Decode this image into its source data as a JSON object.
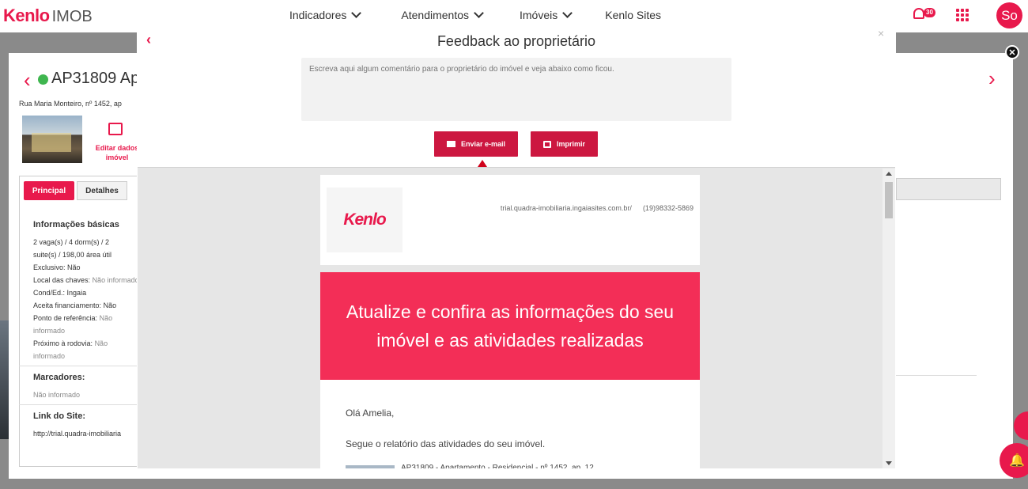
{
  "header": {
    "logo_brand": "Kenlo",
    "logo_product": "IMOB",
    "nav": [
      {
        "label": "Indicadores",
        "has_dropdown": true
      },
      {
        "label": "Atendimentos",
        "has_dropdown": true
      },
      {
        "label": "Imóveis",
        "has_dropdown": true
      },
      {
        "label": "Kenlo Sites",
        "has_dropdown": false
      }
    ],
    "notification_count": "30",
    "avatar_initials": "So",
    "accent_color": "#e8194c"
  },
  "property": {
    "code": "AP31809",
    "title_fragment": "Ap",
    "status_color": "#3fb64f",
    "address": "Rua Maria Monteiro, nº 1452, ap",
    "edit_label": "Editar dados imóvel",
    "tabs": [
      "Principal",
      "Detalhes"
    ],
    "basic_info_title": "Informações básicas",
    "basic_info_lines": [
      "2 vaga(s) / 4 dorm(s) / 2",
      "suite(s) / 198,00 área útil"
    ],
    "fields": [
      {
        "label": "Exclusivo:",
        "value": "Não"
      },
      {
        "label": "Local das chaves:",
        "value": "Não informado"
      },
      {
        "label": "Cond/Ed.:",
        "value": "Ingaia"
      },
      {
        "label": "Aceita financiamento:",
        "value": "Não"
      },
      {
        "label": "Ponto de referência:",
        "value": "Não informado"
      },
      {
        "label": "Próximo à rodovia:",
        "value": "Não informado"
      }
    ],
    "markers_title": "Marcadores:",
    "markers_value": "Não informado",
    "site_link_title": "Link do Site:",
    "site_link_value": "http://trial.quadra-imobiliaria"
  },
  "modal": {
    "title": "Feedback ao proprietário",
    "comment_placeholder": "Escreva aqui algum comentário para o proprietário do imóvel e veja abaixo como ficou.",
    "send_email_label": "Enviar e-mail",
    "print_label": "Imprimir",
    "close_symbol": "×",
    "back_symbol": "‹"
  },
  "email_preview": {
    "logo_text": "Kenlo",
    "site_url": "trial.quadra-imobiliaria.ingaiasites.com.br/",
    "phone": "(19)98332-5869",
    "banner_text": "Atualize e confira as informações do seu imóvel e as atividades realizadas",
    "banner_color": "#f32e57",
    "greeting": "Olá Amelia,",
    "report_line": "Segue o relatório das atividades do seu imóvel.",
    "item_preview": "AP31809 - Apartamento - Residencial - nº 1452, ap. 12"
  }
}
